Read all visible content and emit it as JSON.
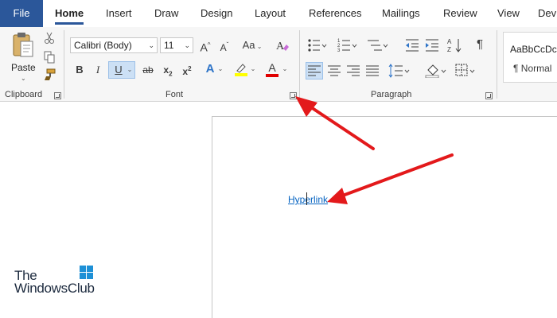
{
  "tabs": [
    {
      "id": "file",
      "label": "File"
    },
    {
      "id": "home",
      "label": "Home"
    },
    {
      "id": "insert",
      "label": "Insert"
    },
    {
      "id": "draw",
      "label": "Draw"
    },
    {
      "id": "design",
      "label": "Design"
    },
    {
      "id": "layout",
      "label": "Layout"
    },
    {
      "id": "references",
      "label": "References"
    },
    {
      "id": "mailings",
      "label": "Mailings"
    },
    {
      "id": "review",
      "label": "Review"
    },
    {
      "id": "view",
      "label": "View"
    },
    {
      "id": "dev",
      "label": "Dev"
    }
  ],
  "clipboard": {
    "group_label": "Clipboard",
    "paste_label": "Paste"
  },
  "font": {
    "group_label": "Font",
    "font_name": "Calibri (Body)",
    "font_size": "11",
    "bold": "B",
    "italic": "I",
    "underline": "U",
    "strike": "ab",
    "grow": "A",
    "shrink": "A",
    "case": "Aa",
    "text_effects": "A",
    "font_color": "A",
    "colors": {
      "highlight": "#ffff00",
      "font_color": "#e00000",
      "underline_active": "#cce0f5"
    }
  },
  "paragraph": {
    "group_label": "Paragraph",
    "pilcrow": "¶"
  },
  "styles": {
    "preview": "AaBbCcDc",
    "normal_label": "¶ Normal"
  },
  "document": {
    "hyperlink_text": "Hyperlink"
  },
  "watermark": {
    "line1": "The",
    "line2": "WindowsClub"
  },
  "accent": "#2b579a"
}
